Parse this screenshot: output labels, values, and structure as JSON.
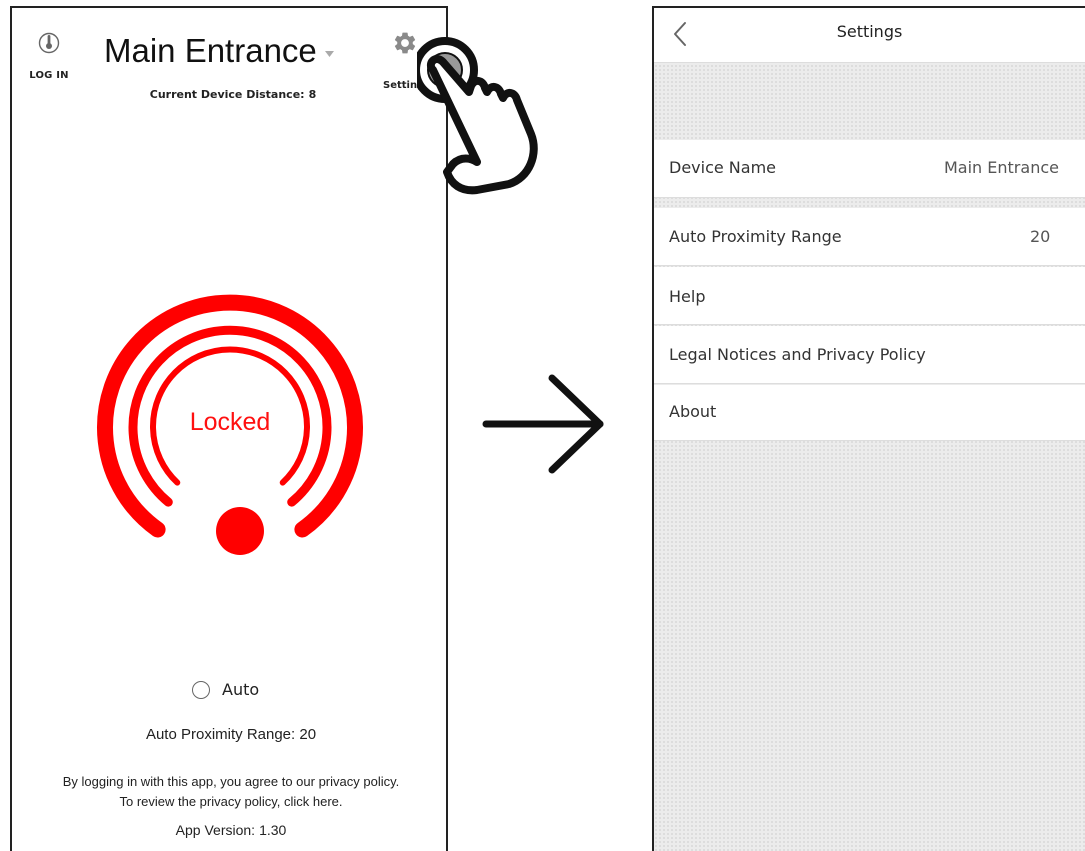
{
  "left_screen": {
    "login_label": "LOG IN",
    "device_title": "Main Entrance",
    "distance_label": "Current Device Distance:",
    "distance_value": "8",
    "settings_label": "Settings",
    "lock_status": "Locked",
    "auto_label": "Auto",
    "range_text": "Auto Proximity Range: 20",
    "policy_line1": "By logging in with this app, you agree to our privacy policy.",
    "policy_line2": "To review the privacy policy, click here.",
    "version_label": "App Version:",
    "version_value": "1.30",
    "lock_color": "#ff0000"
  },
  "right_screen": {
    "title": "Settings",
    "rows": [
      {
        "label": "Device Name",
        "value": "Main Entrance"
      },
      {
        "label": "Auto Proximity Range",
        "value": "20"
      },
      {
        "label": "Help"
      },
      {
        "label": "Legal Notices and Privacy Policy"
      },
      {
        "label": "About"
      }
    ]
  },
  "icons": {
    "login": "thermometer-icon",
    "settings": "gear-icon",
    "back": "chevron-left-icon",
    "transition": "arrow-right-icon",
    "tap": "hand-pointer-icon"
  }
}
